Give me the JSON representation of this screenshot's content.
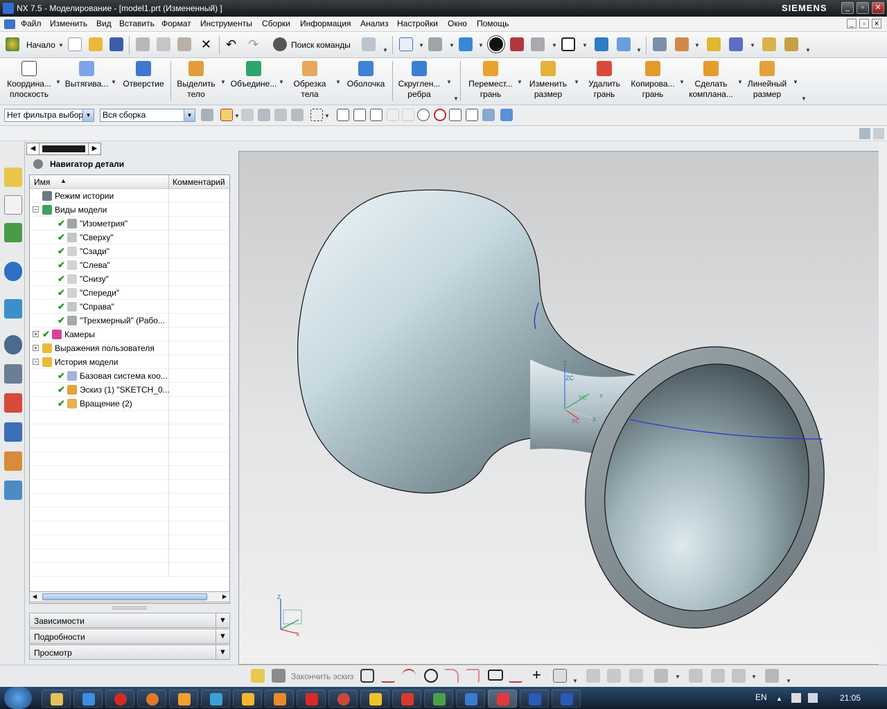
{
  "window": {
    "title": "NX 7.5 - Моделирование - [model1.prt (Измененный) ]",
    "brand": "SIEMENS"
  },
  "menu": [
    "Файл",
    "Изменить",
    "Вид",
    "Вставить",
    "Формат",
    "Инструменты",
    "Сборки",
    "Информация",
    "Анализ",
    "Настройки",
    "Окно",
    "Помощь"
  ],
  "toolbar1": {
    "start_label": "Начало",
    "search_label": "Поиск команды"
  },
  "toolbar2": [
    {
      "l1": "Координа...",
      "l2": "плоскость"
    },
    {
      "l1": "Вытягива...",
      "l2": ""
    },
    {
      "l1": "Отверстие",
      "l2": ""
    },
    {
      "l1": "Выделить",
      "l2": "тело"
    },
    {
      "l1": "Объедине...",
      "l2": ""
    },
    {
      "l1": "Обрезка",
      "l2": "тела"
    },
    {
      "l1": "Оболочка",
      "l2": ""
    },
    {
      "l1": "Скруглен...",
      "l2": "ребра"
    },
    {
      "l1": "Перемест...",
      "l2": "грань"
    },
    {
      "l1": "Изменить",
      "l2": "размер"
    },
    {
      "l1": "Удалить",
      "l2": "грань"
    },
    {
      "l1": "Копирова...",
      "l2": "грань"
    },
    {
      "l1": "Сделать",
      "l2": "компланa..."
    },
    {
      "l1": "Линейный",
      "l2": "размер"
    }
  ],
  "filters": {
    "type_filter": "Нет фильтра выбор",
    "scope_filter": "Вся сборка"
  },
  "navigator": {
    "title": "Навигатор детали",
    "col_name": "Имя",
    "col_comment": "Комментарий",
    "rows": [
      {
        "text": "Режим истории"
      },
      {
        "text": "Виды модели"
      },
      {
        "text": "\"Изометрия\""
      },
      {
        "text": "\"Сверху\""
      },
      {
        "text": "\"Сзади\""
      },
      {
        "text": "\"Слева\""
      },
      {
        "text": "\"Снизу\""
      },
      {
        "text": "\"Спереди\""
      },
      {
        "text": "\"Справа\""
      },
      {
        "text": "\"Трехмерный\" (Рабо..."
      },
      {
        "text": "Камеры"
      },
      {
        "text": "Выражения пользователя"
      },
      {
        "text": "История модели"
      },
      {
        "text": "Базовая система коо..."
      },
      {
        "text": "Эскиз (1) \"SKETCH_0..."
      },
      {
        "text": "Вращение (2)"
      }
    ],
    "panels": [
      "Зависимости",
      "Подробности",
      "Просмотр"
    ]
  },
  "viewport": {
    "triad_main": {
      "z": "ZC",
      "y": "YC",
      "x": "XC",
      "z2": "Z",
      "y2": "Y",
      "x2": "X"
    },
    "triad_corner": {
      "z": "Z",
      "x": "X"
    }
  },
  "sketchbar": {
    "finish_label": "Закончить эскиз"
  },
  "taskbar": {
    "lang": "EN",
    "time": "21:05"
  }
}
